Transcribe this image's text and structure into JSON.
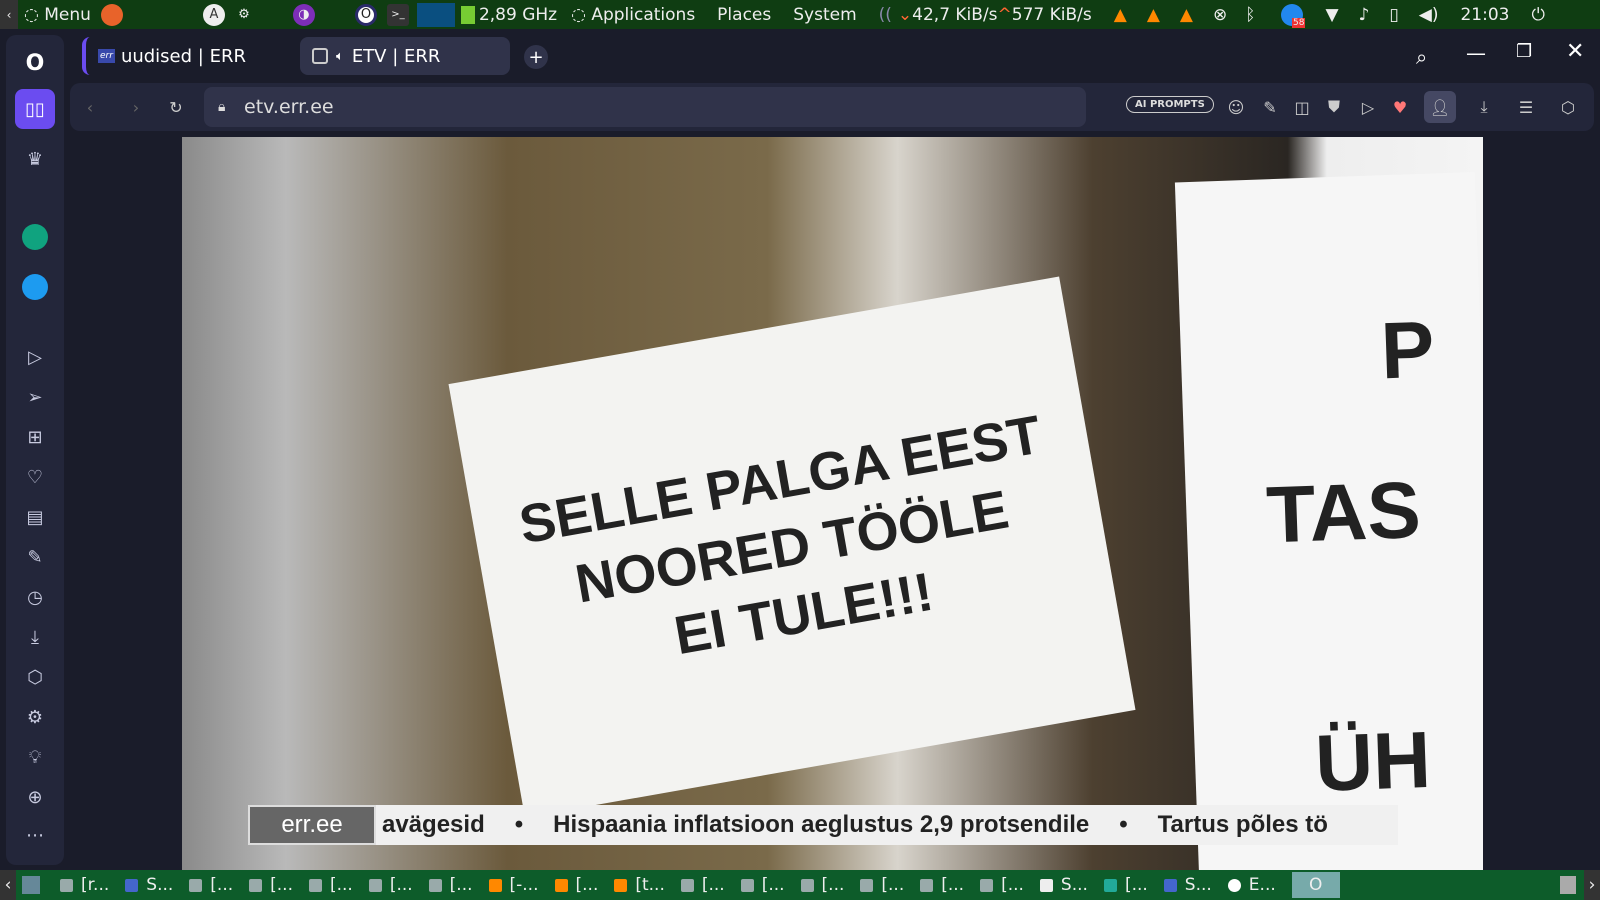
{
  "topbar": {
    "menu": "Menu",
    "cpu": "2,89 GHz",
    "applications": "Applications",
    "places": "Places",
    "system": "System",
    "down": "42,7 KiB/s",
    "up": "577 KiB/s",
    "time": "21:03",
    "badge": "58"
  },
  "tabs": [
    {
      "label": "uudised | ERR",
      "favicon": "err"
    },
    {
      "label": "ETV | ERR"
    }
  ],
  "address": {
    "url": "etv.err.ee",
    "ai_prompts": "AI PROMPTS"
  },
  "video": {
    "sign_lines": [
      "SELLE PALGA EEST",
      "NOORED TÖÖLE",
      "EI TULE!!!"
    ],
    "right_sign": [
      "P",
      "TAS",
      "ÜH"
    ],
    "ticker_logo": "err.ee",
    "ticker": [
      "avägesid",
      "Hispaania inflatsioon aeglustus 2,9 protsendile",
      "Tartus põles tö"
    ],
    "bullet": "•"
  },
  "taskbar": {
    "items": [
      "[r...",
      "S...",
      "[...",
      "[...",
      "[...",
      "[...",
      "[...",
      "[-...",
      "[...",
      "[t...",
      "[...",
      "[...",
      "[...",
      "[...",
      "[...",
      "[...",
      "S...",
      "[...",
      "S...",
      "E..."
    ]
  }
}
